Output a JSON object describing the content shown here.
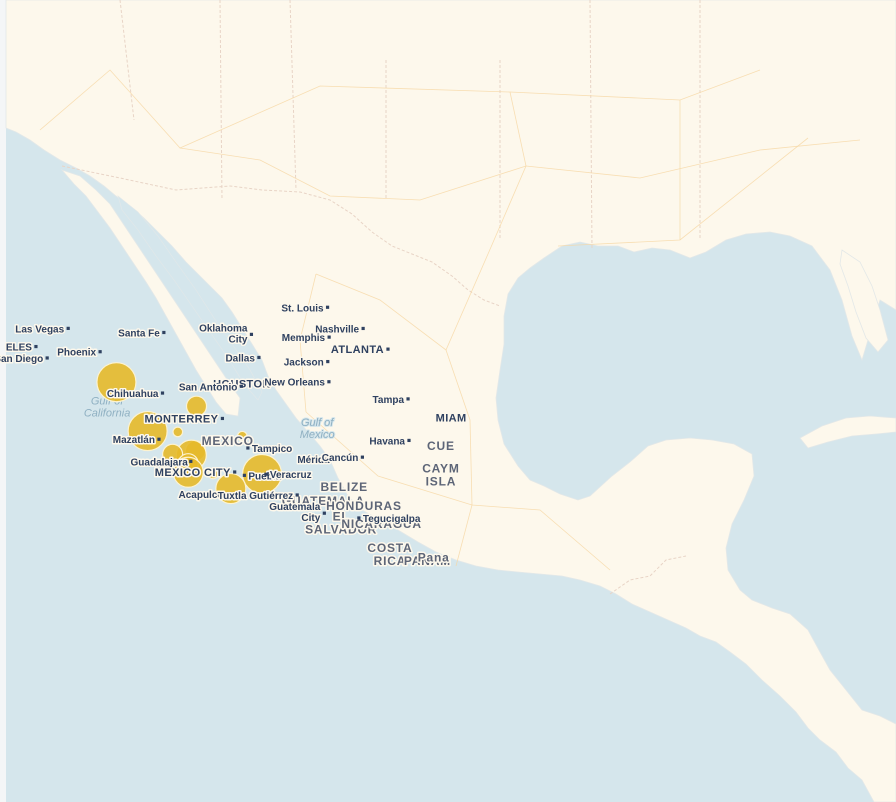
{
  "map": {
    "water_color": "#d5e6ec",
    "land_color": "#fdf8ec",
    "bubble_color": "#e6b92a",
    "cities": [
      {
        "name": "St. Louis",
        "lat": 38.63,
        "lon": -90.2
      },
      {
        "name": "Las Vegas",
        "lat": 36.17,
        "lon": -115.14
      },
      {
        "name": "Santa Fe",
        "lat": 35.69,
        "lon": -105.94
      },
      {
        "name": "Oklahoma City",
        "lat": 35.47,
        "lon": -97.52
      },
      {
        "name": "Nashville",
        "lat": 36.16,
        "lon": -86.78
      },
      {
        "name": "Memphis",
        "lat": 35.15,
        "lon": -90.05
      },
      {
        "name": "ELES",
        "lat": 34.05,
        "lon": -118.24
      },
      {
        "name": "ATLANTA",
        "lat": 33.75,
        "lon": -84.39
      },
      {
        "name": "Phoenix",
        "lat": 33.45,
        "lon": -112.07
      },
      {
        "name": "San Diego",
        "lat": 32.72,
        "lon": -117.16
      },
      {
        "name": "Dallas",
        "lat": 32.78,
        "lon": -96.8
      },
      {
        "name": "Jackson",
        "lat": 32.3,
        "lon": -90.18
      },
      {
        "name": "HOUSTON",
        "lat": 29.76,
        "lon": -95.37
      },
      {
        "name": "New Orleans",
        "lat": 29.95,
        "lon": -90.07
      },
      {
        "name": "San Antonio",
        "lat": 29.42,
        "lon": -98.49
      },
      {
        "name": "Chihuahua",
        "lat": 28.63,
        "lon": -106.07
      },
      {
        "name": "Tampa",
        "lat": 27.95,
        "lon": -82.46
      },
      {
        "name": "MONTERREY",
        "lat": 25.67,
        "lon": -100.31
      },
      {
        "name": "MIAM",
        "lat": 25.76,
        "lon": -80.19
      },
      {
        "name": "Havana",
        "lat": 23.11,
        "lon": -82.37
      },
      {
        "name": "Mazatlán",
        "lat": 23.25,
        "lon": -106.41
      },
      {
        "name": "Tampico",
        "lat": 22.23,
        "lon": -97.86
      },
      {
        "name": "Mérida",
        "lat": 20.97,
        "lon": -89.62
      },
      {
        "name": "Cancún",
        "lat": 21.16,
        "lon": -86.85
      },
      {
        "name": "Guadalajara",
        "lat": 20.67,
        "lon": -103.35
      },
      {
        "name": "MEXICO CITY",
        "lat": 19.43,
        "lon": -99.13
      },
      {
        "name": "Puebla",
        "lat": 19.04,
        "lon": -98.2
      },
      {
        "name": "Veracruz",
        "lat": 19.17,
        "lon": -96.13
      },
      {
        "name": "Acapulco",
        "lat": 16.85,
        "lon": -99.82
      },
      {
        "name": "Tuxtla Gutiérrez",
        "lat": 16.75,
        "lon": -93.12
      },
      {
        "name": "Guatemala City",
        "lat": 14.63,
        "lon": -90.51
      },
      {
        "name": "Tegucigalpa",
        "lat": 14.07,
        "lon": -87.19
      }
    ],
    "countries": [
      {
        "name": "MEXICO",
        "lat": 22.6,
        "lon": -99.8
      },
      {
        "name": "BELIZE",
        "lat": 17.2,
        "lon": -88.6
      },
      {
        "name": "GUATEMALA",
        "lat": 15.6,
        "lon": -90.6
      },
      {
        "name": "HONDURAS",
        "lat": 15.0,
        "lon": -86.7
      },
      {
        "name": "EL SALVADOR",
        "lat": 13.8,
        "lon": -88.9
      },
      {
        "name": "NICARAGUA",
        "lat": 12.9,
        "lon": -85.0
      },
      {
        "name": "COSTA RICA",
        "lat": 10.1,
        "lon": -84.2
      },
      {
        "name": "PANAM",
        "lat": 8.6,
        "lon": -80.6
      },
      {
        "name": "CUE",
        "lat": 22.0,
        "lon": -79.3
      },
      {
        "name": "CAYM ISLA",
        "lat": 19.4,
        "lon": -79.3
      },
      {
        "name": "Pana",
        "lat": 9.0,
        "lon": -80.0
      }
    ],
    "water_labels": [
      {
        "name": "Gulf of California",
        "lat": 27.3,
        "lon": -111.4
      },
      {
        "name": "Gulf of Mexico",
        "lat": 24.8,
        "lon": -91.2
      }
    ],
    "bubbles": [
      {
        "lat": 29.9,
        "lon": -110.5,
        "size": 3
      },
      {
        "lat": 27.1,
        "lon": -102.8,
        "size": 1
      },
      {
        "lat": 24.2,
        "lon": -107.5,
        "size": 3
      },
      {
        "lat": 24.1,
        "lon": -104.6,
        "size": 0.4
      },
      {
        "lat": 23.6,
        "lon": -98.4,
        "size": 0.4
      },
      {
        "lat": 21.9,
        "lon": -102.9,
        "size": 1
      },
      {
        "lat": 21.4,
        "lon": -103.3,
        "size": 2
      },
      {
        "lat": 21.5,
        "lon": -105.1,
        "size": 1
      },
      {
        "lat": 20.4,
        "lon": -103.6,
        "size": 1
      },
      {
        "lat": 19.4,
        "lon": -103.6,
        "size": 2
      },
      {
        "lat": 19.2,
        "lon": -101.2,
        "size": 0.4
      },
      {
        "lat": 19.2,
        "lon": -96.5,
        "size": 3
      },
      {
        "lat": 17.5,
        "lon": -99.5,
        "size": 2
      }
    ]
  }
}
